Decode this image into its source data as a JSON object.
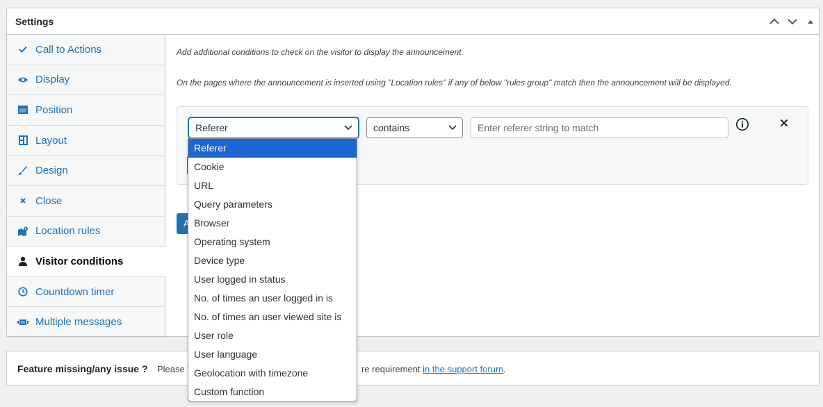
{
  "panel": {
    "title": "Settings",
    "header_buttons": [
      "chevron-up-icon",
      "chevron-down-icon",
      "triangle-up-icon"
    ]
  },
  "tabs": [
    {
      "label": "Call to Actions",
      "icon": "check-icon"
    },
    {
      "label": "Display",
      "icon": "eye-icon"
    },
    {
      "label": "Position",
      "icon": "window-icon"
    },
    {
      "label": "Layout",
      "icon": "layout-icon"
    },
    {
      "label": "Design",
      "icon": "brush-icon"
    },
    {
      "label": "Close",
      "icon": "close-icon"
    },
    {
      "label": "Location rules",
      "icon": "map-icon"
    },
    {
      "label": "Visitor conditions",
      "icon": "user-icon",
      "active": true
    },
    {
      "label": "Countdown timer",
      "icon": "clock-icon"
    },
    {
      "label": "Multiple messages",
      "icon": "slides-icon"
    }
  ],
  "content": {
    "description_1": "Add additional conditions to check on the visitor to display the announcement.",
    "description_2": "On the pages where the announcement is inserted using \"Location rules\" if any of below \"rules group\" match then the announcement will be displayed.",
    "rule": {
      "param_value": "Referer",
      "operator_value": "contains",
      "value_placeholder": "Enter referer string to match"
    },
    "add_button_label": "A"
  },
  "dropdown": {
    "options": [
      "Referer",
      "Cookie",
      "URL",
      "Query parameters",
      "Browser",
      "Operating system",
      "Device type",
      "User logged in status",
      "No. of times an user logged in is",
      "No. of times an user viewed site is",
      "User role",
      "User language",
      "Geolocation with timezone",
      "Custom function"
    ],
    "selected": "Referer"
  },
  "footer": {
    "title": "Feature missing/any issue ?",
    "text_left": "Please f",
    "text_right": "re requirement",
    "link": "in the support forum",
    "suffix": "."
  },
  "colors": {
    "accent": "#2271b1",
    "selected_option": "#1e66d0",
    "background": "#f0f0f1"
  }
}
